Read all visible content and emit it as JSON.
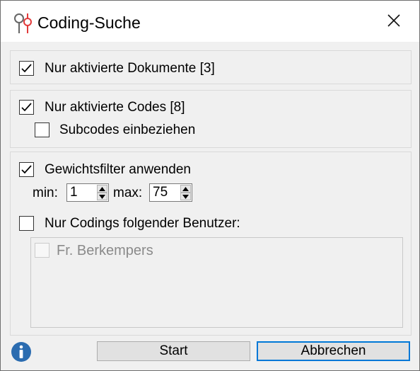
{
  "window": {
    "title": "Coding-Suche"
  },
  "options": {
    "only_activated_documents": {
      "label": "Nur aktivierte Dokumente [3]",
      "checked": true
    },
    "only_activated_codes": {
      "label": "Nur aktivierte Codes [8]",
      "checked": true
    },
    "include_subcodes": {
      "label": "Subcodes einbeziehen",
      "checked": false
    },
    "weight_filter": {
      "label": "Gewichtsfilter anwenden",
      "checked": true
    },
    "min_label": "min:",
    "min_value": "1",
    "max_label": "max:",
    "max_value": "75",
    "only_user_codings": {
      "label": "Nur Codings folgender Benutzer:",
      "checked": false
    }
  },
  "users": [
    {
      "label": "Fr. Berkempers",
      "checked": false,
      "enabled": false
    }
  ],
  "buttons": {
    "start": "Start",
    "cancel": "Abbrechen"
  },
  "icons": {
    "app": "magnifier-icon",
    "close": "close-icon",
    "info": "info-icon"
  },
  "colors": {
    "accent": "#0078d7",
    "info": "#2b6cb0",
    "app_icon_red": "#e23b3b"
  }
}
